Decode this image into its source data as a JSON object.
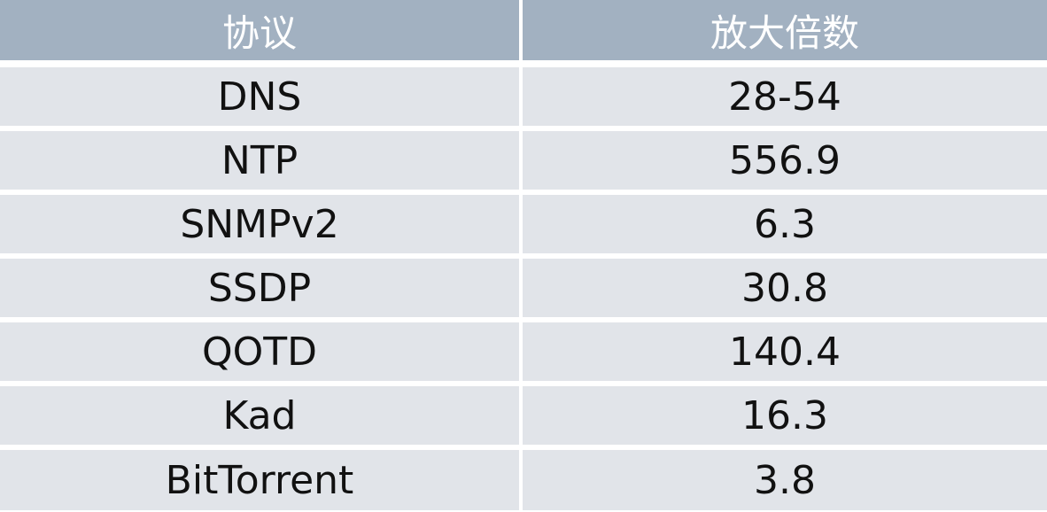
{
  "table": {
    "headers": [
      "协议",
      "放大倍数"
    ],
    "rows": [
      {
        "protocol": "DNS",
        "factor": "28-54"
      },
      {
        "protocol": "NTP",
        "factor": "556.9"
      },
      {
        "protocol": "SNMPv2",
        "factor": "6.3"
      },
      {
        "protocol": "SSDP",
        "factor": "30.8"
      },
      {
        "protocol": "QOTD",
        "factor": "140.4"
      },
      {
        "protocol": "Kad",
        "factor": "16.3"
      },
      {
        "protocol": "BitTorrent",
        "factor": "3.8"
      }
    ]
  },
  "colors": {
    "header_bg": "#a2b1c1",
    "header_text": "#ffffff",
    "row_bg": "#e1e4e9",
    "row_text": "#111111",
    "divider": "#ffffff"
  }
}
